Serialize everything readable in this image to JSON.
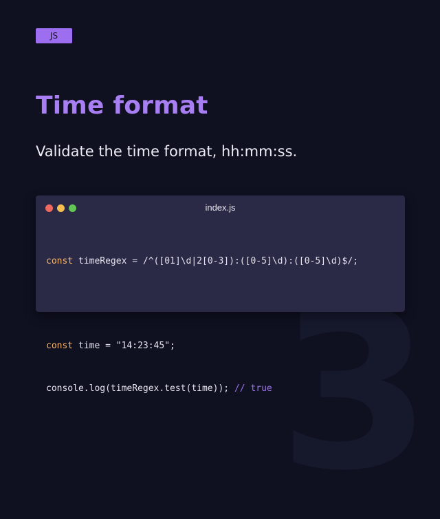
{
  "badge": {
    "label": "JS"
  },
  "title": "Time format",
  "subtitle": "Validate the time format, hh:mm:ss.",
  "background_number": "3",
  "colors": {
    "background": "#0f1020",
    "accent": "#a87ff2",
    "badge": "#9d6ff0",
    "window": "#2a2946",
    "keyword": "#f4b56d",
    "comment": "#9b74ea",
    "dot_red": "#ee6a5f",
    "dot_yellow": "#f5be4f",
    "dot_green": "#62c554"
  },
  "window": {
    "file_name": "index.js",
    "dots": [
      "close-dot",
      "minimize-dot",
      "maximize-dot"
    ]
  },
  "code": {
    "line1": {
      "kw": "const",
      "name": "timeRegex",
      "op": "=",
      "regex": "/^([01]\\d|2[0-3]):([0-5]\\d):([0-5]\\d)$/;"
    },
    "line3": {
      "kw": "const",
      "name": "time",
      "op": "=",
      "value": "\"14:23:45\";"
    },
    "line4": {
      "call": "console.log(timeRegex.test(time));",
      "comment": "// true"
    }
  }
}
